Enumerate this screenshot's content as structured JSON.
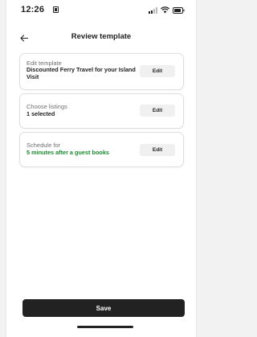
{
  "status_bar": {
    "time": "12:26"
  },
  "header": {
    "title": "Review template"
  },
  "cards": [
    {
      "label": "Edit template",
      "value": "Discounted Ferry Travel for your Island Visit",
      "button": "Edit"
    },
    {
      "label": "Choose listings",
      "value": "1 selected",
      "button": "Edit"
    },
    {
      "label": "Schedule for",
      "value": "5 minutes after a guest books",
      "button": "Edit",
      "value_color": "#1a8a2e"
    }
  ],
  "footer": {
    "save_label": "Save"
  },
  "icons": [
    "sim-icon",
    "signal-icon",
    "wifi-icon",
    "battery-icon",
    "back-arrow-icon",
    "home-indicator"
  ],
  "colors": {
    "primary_button": "#222222",
    "accent_green": "#1a8a2e",
    "card_border": "#dedede"
  }
}
